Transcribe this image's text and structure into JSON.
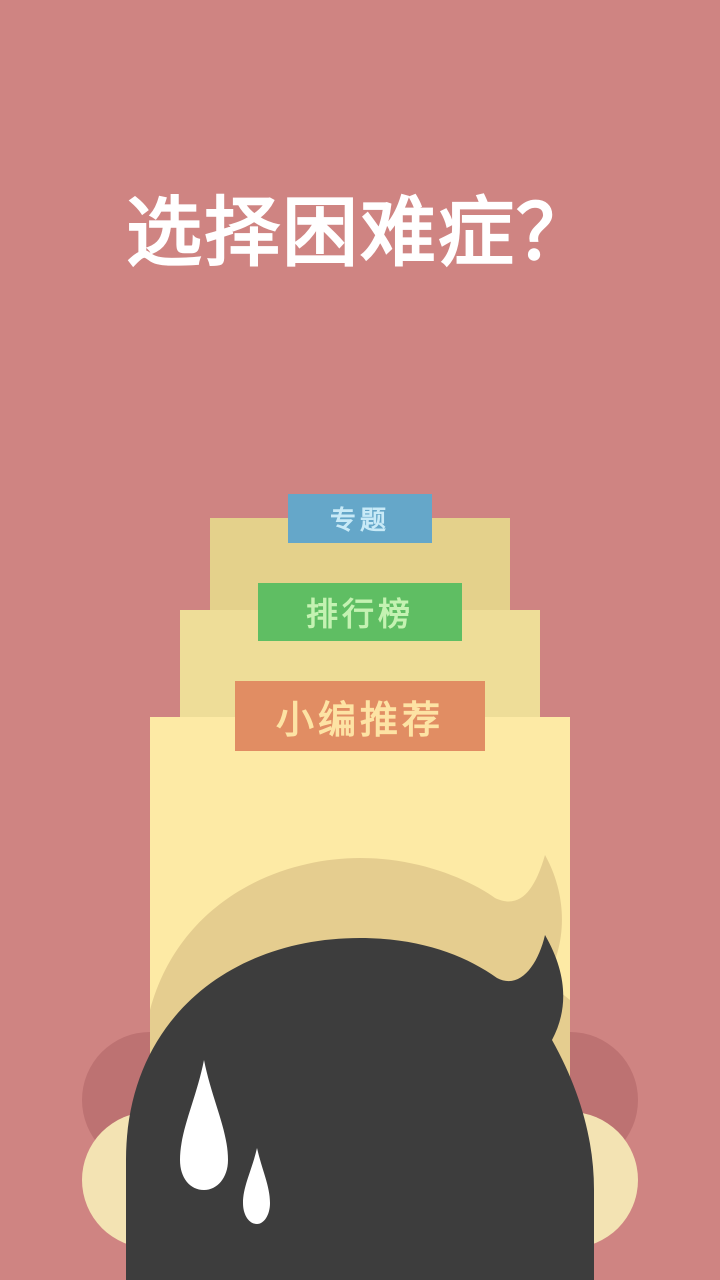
{
  "screen": {
    "title": "选择困难症？",
    "background_color": "#cf8482"
  },
  "menu": {
    "items": [
      {
        "id": "topics",
        "label": "专题",
        "color": "#65a7c9"
      },
      {
        "id": "ranking",
        "label": "排行榜",
        "color": "#5fbe63"
      },
      {
        "id": "editor_picks",
        "label": "小编推荐",
        "color": "#e18d63"
      }
    ]
  },
  "illustration": {
    "icons": [
      "paper-stack",
      "hair-blob",
      "sweat-drop-icon"
    ],
    "colors": {
      "hair": "#3d3d3d",
      "skin": "#f3e3b3",
      "sweat": "#ffffff"
    }
  }
}
